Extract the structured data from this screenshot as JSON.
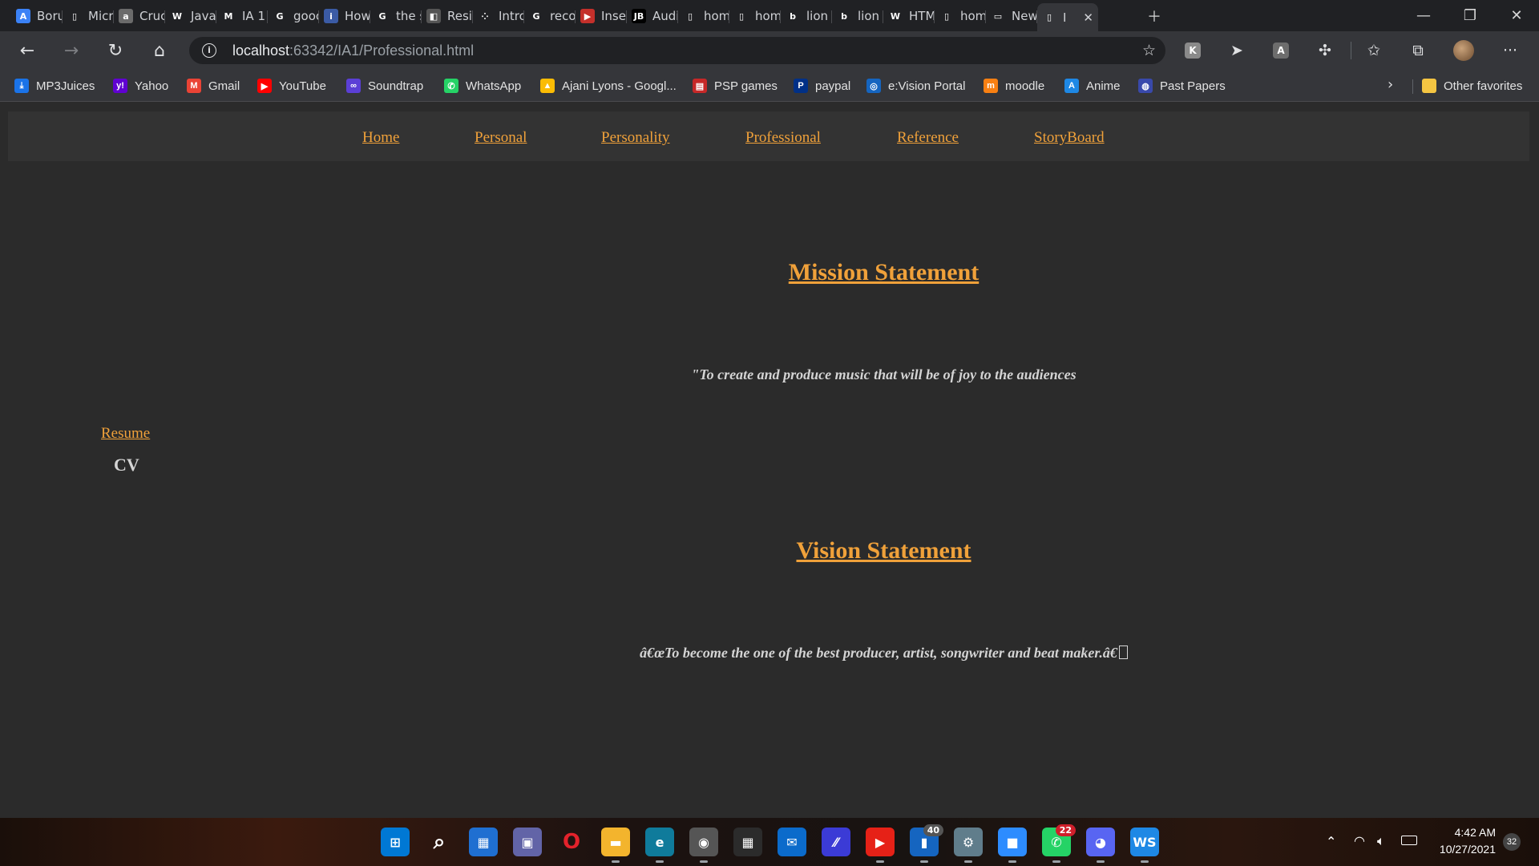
{
  "browser": {
    "tabs": [
      {
        "label": "Boru",
        "icon": "aliexpress-icon"
      },
      {
        "label": "Micr",
        "icon": "page-icon"
      },
      {
        "label": "Cruc",
        "icon": "amazon-icon"
      },
      {
        "label": "Java",
        "icon": "w3schools-icon"
      },
      {
        "label": "IA 1",
        "icon": "gmail-icon"
      },
      {
        "label": "gooc",
        "icon": "google-icon"
      },
      {
        "label": "How",
        "icon": "info-icon"
      },
      {
        "label": "the s",
        "icon": "google-icon"
      },
      {
        "label": "Resiz",
        "icon": "resize-icon"
      },
      {
        "label": "Intro",
        "icon": "dots-icon"
      },
      {
        "label": "recor",
        "icon": "google-icon"
      },
      {
        "label": "Inser",
        "icon": "youtube-icon"
      },
      {
        "label": "Audi",
        "icon": "jetbrains-icon"
      },
      {
        "label": "hom",
        "icon": "page-icon"
      },
      {
        "label": "hom",
        "icon": "page-icon"
      },
      {
        "label": "lion",
        "icon": "bing-icon"
      },
      {
        "label": "lion",
        "icon": "bing-icon"
      },
      {
        "label": "HTM",
        "icon": "w3schools-icon"
      },
      {
        "label": "hom",
        "icon": "page-icon"
      },
      {
        "label": "New",
        "icon": "newtab-icon"
      },
      {
        "label": "I",
        "icon": "page-icon",
        "active": true
      }
    ],
    "url": {
      "host": "localhost",
      "path": ":63342/IA1/Professional.html"
    },
    "bookmarks": [
      {
        "label": "MP3Juices",
        "icon": "download-icon",
        "color": "#1a73e8"
      },
      {
        "label": "Yahoo",
        "icon": "yahoo-icon",
        "color": "#6001d2"
      },
      {
        "label": "Gmail",
        "icon": "gmail-icon",
        "color": "#ea4335"
      },
      {
        "label": "YouTube",
        "icon": "youtube-icon",
        "color": "#ff0000"
      },
      {
        "label": "Soundtrap",
        "icon": "soundtrap-icon",
        "color": "#5b3fd6"
      },
      {
        "label": "WhatsApp",
        "icon": "whatsapp-icon",
        "color": "#25d366"
      },
      {
        "label": "Ajani Lyons - Googl...",
        "icon": "drive-icon",
        "color": "#fbbc04"
      },
      {
        "label": "PSP games",
        "icon": "psp-icon",
        "color": "#c62828"
      },
      {
        "label": "paypal",
        "icon": "paypal-icon",
        "color": "#003087"
      },
      {
        "label": "e:Vision Portal",
        "icon": "evision-icon",
        "color": "#1565c0"
      },
      {
        "label": "moodle",
        "icon": "moodle-icon",
        "color": "#f98012"
      },
      {
        "label": "Anime",
        "icon": "anime-icon",
        "color": "#1e88e5"
      },
      {
        "label": "Past Papers",
        "icon": "globe-icon",
        "color": "#3949ab"
      }
    ],
    "other_favorites": "Other favorites"
  },
  "site": {
    "nav": [
      "Home",
      "Personal",
      "Personality",
      "Professional",
      "Reference",
      "StoryBoard"
    ],
    "mission_title": "Mission Statement",
    "mission_text": "\"To create and produce music that will be of joy to the audiences",
    "vision_title": "Vision Statement",
    "vision_text": "â€œTo become the one of the best producer, artist, songwriter and beat maker.â€",
    "resume_link": "Resume",
    "cv_label": "CV",
    "accent_color": "#f0a13a"
  },
  "taskbar": {
    "apps": [
      {
        "name": "start-icon"
      },
      {
        "name": "search-icon"
      },
      {
        "name": "widgets-icon"
      },
      {
        "name": "teams-chat-icon"
      },
      {
        "name": "opera-icon"
      },
      {
        "name": "file-explorer-icon"
      },
      {
        "name": "edge-icon"
      },
      {
        "name": "media-player-icon"
      },
      {
        "name": "store-icon"
      },
      {
        "name": "mail-icon"
      },
      {
        "name": "visual-studio-icon"
      },
      {
        "name": "youtube-music-icon"
      },
      {
        "name": "notes-icon",
        "badge": "40"
      },
      {
        "name": "settings-icon"
      },
      {
        "name": "zoom-icon"
      },
      {
        "name": "whatsapp-icon",
        "badge": "22"
      },
      {
        "name": "discord-icon"
      },
      {
        "name": "webstorm-icon"
      }
    ],
    "time": "4:42 AM",
    "date": "10/27/2021",
    "notifications": "32"
  }
}
